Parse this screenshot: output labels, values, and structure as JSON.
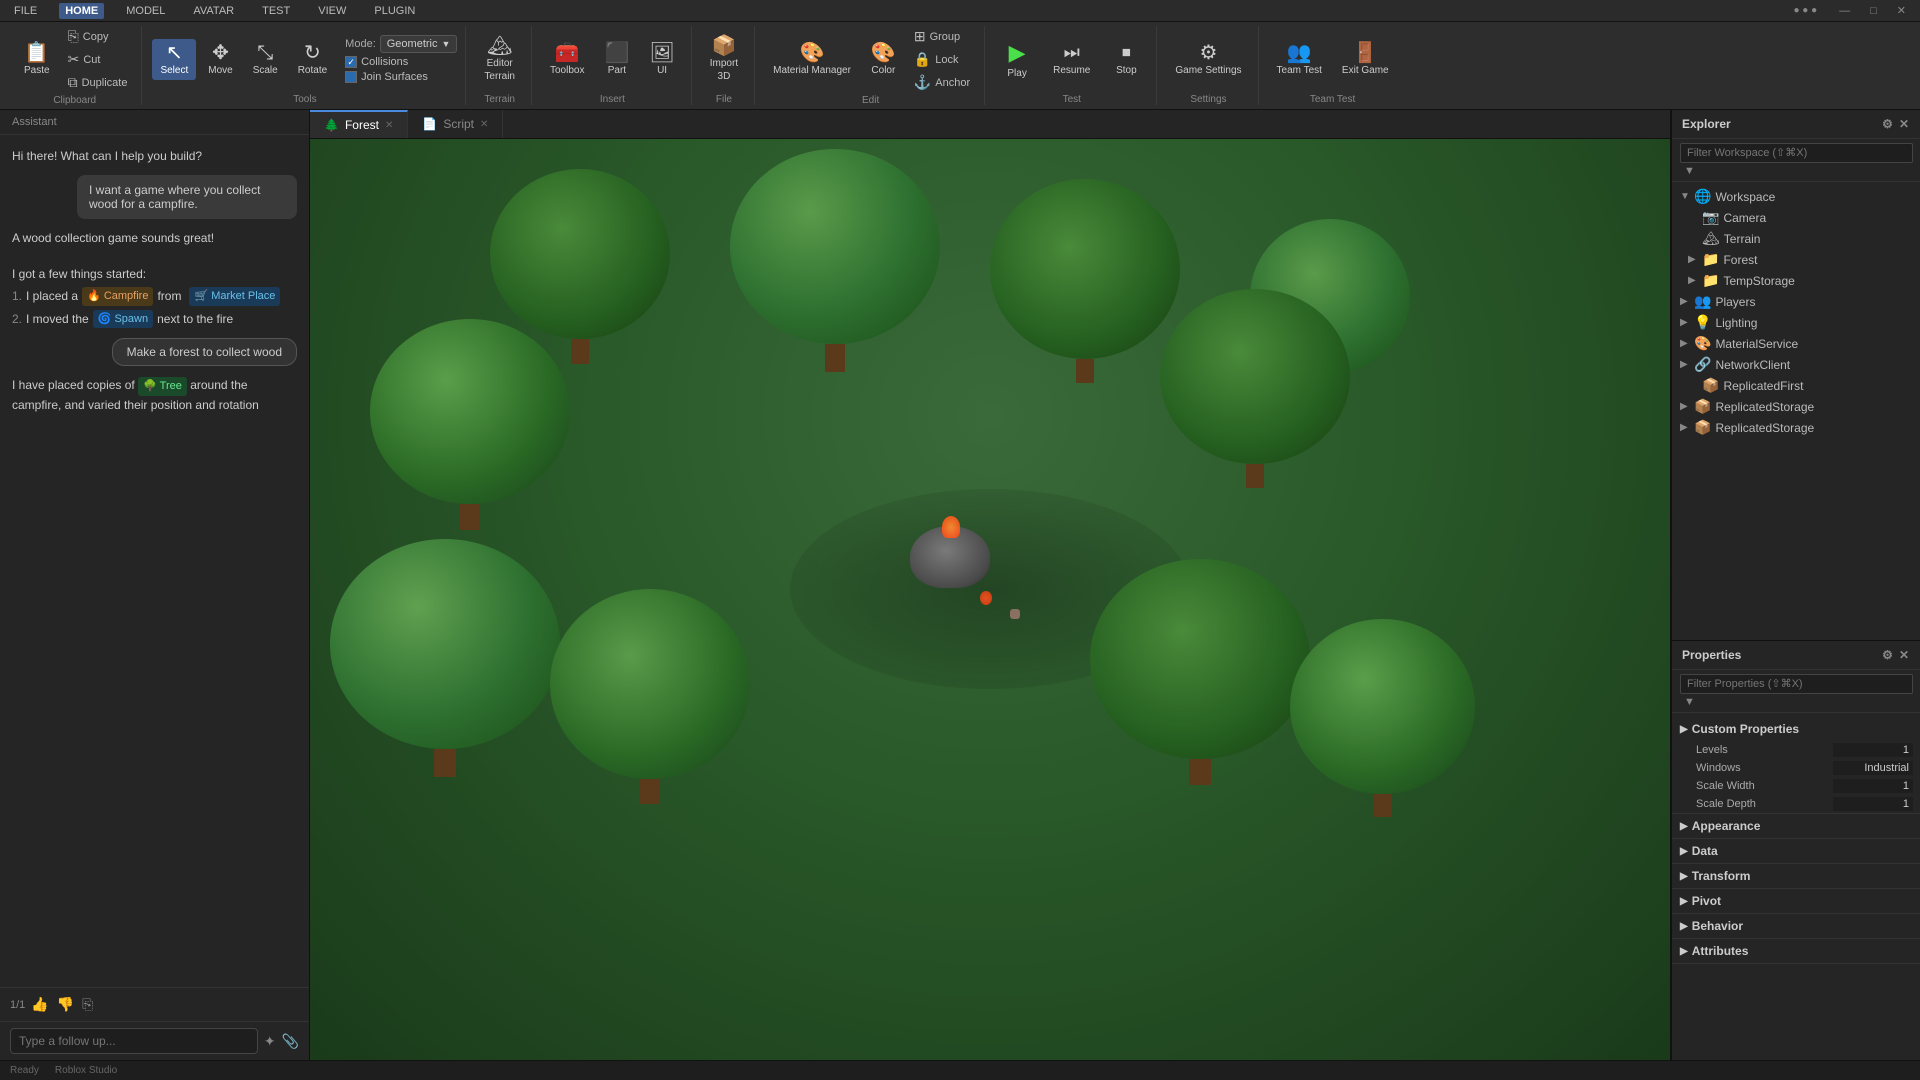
{
  "menubar": {
    "items": [
      "FILE",
      "HOME",
      "MODEL",
      "AVATAR",
      "TEST",
      "VIEW",
      "PLUGIN"
    ],
    "active": "HOME",
    "window_controls": [
      "—",
      "□",
      "✕"
    ]
  },
  "toolbar": {
    "clipboard": {
      "label": "Clipboard",
      "paste_label": "Paste",
      "copy_label": "Copy",
      "cut_label": "Cut",
      "duplicate_label": "Duplicate"
    },
    "tools": {
      "label": "Tools",
      "select_label": "Select",
      "move_label": "Move",
      "scale_label": "Scale",
      "rotate_label": "Rotate",
      "mode_label": "Mode:",
      "mode_value": "Geometric",
      "collisions_label": "Collisions",
      "join_surfaces_label": "Join Surfaces"
    },
    "terrain": {
      "label": "Terrain",
      "editor_label": "Editor",
      "terrain_sublabel": "Terrain"
    },
    "insert": {
      "label": "Insert",
      "toolbox_label": "Toolbox",
      "part_label": "Part",
      "ui_label": "UI"
    },
    "file": {
      "label": "File",
      "import_label": "Import",
      "import_sub": "3D"
    },
    "edit": {
      "label": "Edit",
      "material_label": "Material Manager",
      "color_label": "Color",
      "group_label": "Group",
      "lock_label": "Lock",
      "anchor_label": "Anchor"
    },
    "test": {
      "label": "Test",
      "play_label": "Play",
      "resume_label": "Resume",
      "stop_label": "Stop"
    },
    "settings": {
      "label": "Settings",
      "game_settings_label": "Game Settings"
    },
    "team_test": {
      "label": "Team Test",
      "team_test_label": "Team Test",
      "exit_game_label": "Exit Game"
    }
  },
  "assistant": {
    "header": "Assistant",
    "bot_greeting": "Hi there! What can I help you build?",
    "user_msg1": "I want a game where you collect wood for a campfire.",
    "bot_response1": "A wood collection game sounds great!",
    "bot_list_intro": "I got a few things started:",
    "bot_list_item1_pre": "I placed a",
    "bot_list_item1_tag": "🔥 Campfire",
    "bot_list_item1_post": "from",
    "bot_list_item1_tag2": "🛒 Market Place",
    "bot_list_item2_pre": "I moved the",
    "bot_list_item2_tag": "🌀 Spawn",
    "bot_list_item2_post": "next to the fire",
    "suggestion": "Make a forest to collect wood",
    "bot_response2_pre": "I have placed copies of",
    "bot_response2_tag": "🌳 Tree",
    "bot_response2_post": "around the campfire, and varied their position and rotation",
    "page_indicator": "1/1",
    "input_placeholder": "Type a follow up...",
    "thumbs_up": "👍",
    "thumbs_down": "👎",
    "copy_icon": "⎘",
    "refresh_icon": "↺"
  },
  "viewport": {
    "tabs": [
      {
        "label": "Forest",
        "icon": "🌲",
        "active": true,
        "closable": true
      },
      {
        "label": "Script",
        "icon": "📄",
        "active": false,
        "closable": true
      }
    ]
  },
  "explorer": {
    "title": "Explorer",
    "filter_placeholder": "Filter Workspace (⇧⌘X)",
    "tree": [
      {
        "level": 0,
        "label": "Workspace",
        "icon": "🌐",
        "expanded": true,
        "arrow": "▼"
      },
      {
        "level": 1,
        "label": "Camera",
        "icon": "📷",
        "expanded": false,
        "arrow": ""
      },
      {
        "level": 1,
        "label": "Terrain",
        "icon": "🏔",
        "expanded": false,
        "arrow": ""
      },
      {
        "level": 1,
        "label": "Forest",
        "icon": "📁",
        "expanded": false,
        "arrow": "▶",
        "icon_color": "#c8a060"
      },
      {
        "level": 1,
        "label": "TempStorage",
        "icon": "📁",
        "expanded": false,
        "arrow": "▶",
        "icon_color": "#c8a060"
      },
      {
        "level": 0,
        "label": "Players",
        "icon": "👥",
        "expanded": false,
        "arrow": "▶"
      },
      {
        "level": 0,
        "label": "Lighting",
        "icon": "💡",
        "expanded": false,
        "arrow": "▶"
      },
      {
        "level": 0,
        "label": "MaterialService",
        "icon": "🎨",
        "expanded": false,
        "arrow": "▶"
      },
      {
        "level": 0,
        "label": "NetworkClient",
        "icon": "🔗",
        "expanded": false,
        "arrow": "▶"
      },
      {
        "level": 1,
        "label": "ReplicatedFirst",
        "icon": "📦",
        "expanded": false,
        "arrow": ""
      },
      {
        "level": 0,
        "label": "ReplicatedStorage",
        "icon": "📦",
        "expanded": false,
        "arrow": "▶"
      },
      {
        "level": 0,
        "label": "ReplicatedStorage",
        "icon": "📦",
        "expanded": false,
        "arrow": "▶"
      }
    ]
  },
  "properties": {
    "title": "Properties",
    "filter_placeholder": "Filter Properties (⇧⌘X)",
    "custom_properties_label": "Custom Properties",
    "rows": [
      {
        "name": "Levels",
        "value": "1"
      },
      {
        "name": "Windows",
        "value": "Industrial"
      },
      {
        "name": "Scale Width",
        "value": "1"
      },
      {
        "name": "Scale Depth",
        "value": "1"
      }
    ],
    "sections": [
      {
        "label": "Appearance",
        "expanded": false
      },
      {
        "label": "Data",
        "expanded": false
      },
      {
        "label": "Transform",
        "expanded": false
      },
      {
        "label": "Pivot",
        "expanded": false
      },
      {
        "label": "Behavior",
        "expanded": false
      },
      {
        "label": "Attributes",
        "expanded": false
      }
    ]
  },
  "status_bar": {
    "items": [
      "Ready",
      "Roblox Studio"
    ]
  },
  "colors": {
    "accent_blue": "#3d5a8a",
    "active_tab": "#4a8adf",
    "toolbar_bg": "#2d2d2d",
    "panel_bg": "#252525",
    "input_bg": "#1e1e1e"
  }
}
